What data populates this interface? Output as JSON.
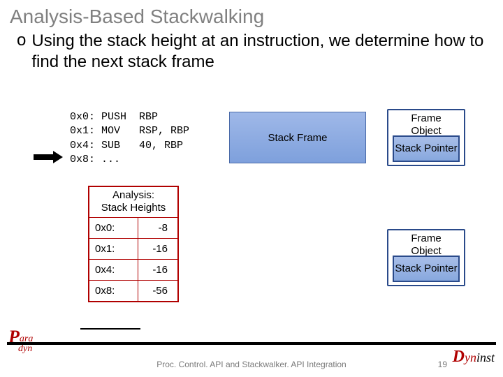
{
  "title": "Analysis-Based Stackwalking",
  "bullet": "Using the stack height at an instruction, we determine how to find the next stack frame",
  "code": "0x0: PUSH  RBP\n0x1: MOV   RSP, RBP\n0x4: SUB   40, RBP\n0x8: ...",
  "stack_frame_label": "Stack Frame",
  "frame_object": {
    "title_line1": "Frame",
    "title_line2": "Object",
    "pointer_label": "Stack\nPointer"
  },
  "analysis": {
    "title_l1": "Analysis:",
    "title_l2": "Stack Heights",
    "rows": [
      {
        "addr": "0x0:",
        "val": "-8"
      },
      {
        "addr": "0x1:",
        "val": "-16"
      },
      {
        "addr": "0x4:",
        "val": "-16"
      },
      {
        "addr": "0x8:",
        "val": "-56"
      }
    ]
  },
  "footer": "Proc. Control. API and Stackwalker. API Integration",
  "slide_number": "19",
  "logos": {
    "left_p": "P",
    "left_ara": "ara",
    "left_dyn": "dyn",
    "right_d": "D",
    "right_yn": "yn",
    "right_inst": "inst"
  }
}
